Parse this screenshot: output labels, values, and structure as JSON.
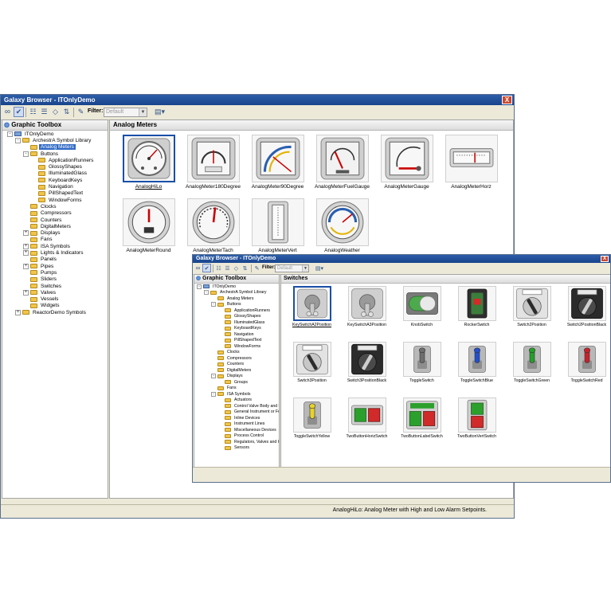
{
  "back_window": {
    "title": "Galaxy Browser - ITOnlyDemo",
    "close_label": "X",
    "filter_label": "Filter:",
    "filter_value": "Default",
    "left_panel_title": "Graphic Toolbox",
    "tree": [
      {
        "label": "ITOnlyDemo",
        "level": 0,
        "exp": "-",
        "icon": "lib"
      },
      {
        "label": "ArchestrA Symbol Library",
        "level": 1,
        "exp": "-",
        "icon": "folder"
      },
      {
        "label": "Analog Meters",
        "level": 2,
        "exp": "",
        "icon": "folder",
        "selected": true
      },
      {
        "label": "Buttons",
        "level": 2,
        "exp": "-",
        "icon": "folder"
      },
      {
        "label": "ApplicationRunners",
        "level": 3,
        "exp": "",
        "icon": "folder"
      },
      {
        "label": "GlossyShapes",
        "level": 3,
        "exp": "",
        "icon": "folder"
      },
      {
        "label": "IlluminatedGlass",
        "level": 3,
        "exp": "",
        "icon": "folder"
      },
      {
        "label": "KeyboardKeys",
        "level": 3,
        "exp": "",
        "icon": "folder"
      },
      {
        "label": "Navigation",
        "level": 3,
        "exp": "",
        "icon": "folder"
      },
      {
        "label": "PillShapedText",
        "level": 3,
        "exp": "",
        "icon": "folder"
      },
      {
        "label": "WindowForms",
        "level": 3,
        "exp": "",
        "icon": "folder"
      },
      {
        "label": "Clocks",
        "level": 2,
        "exp": "",
        "icon": "folder"
      },
      {
        "label": "Compressors",
        "level": 2,
        "exp": "",
        "icon": "folder"
      },
      {
        "label": "Counters",
        "level": 2,
        "exp": "",
        "icon": "folder"
      },
      {
        "label": "DigitalMeters",
        "level": 2,
        "exp": "",
        "icon": "folder"
      },
      {
        "label": "Displays",
        "level": 2,
        "exp": "+",
        "icon": "folder"
      },
      {
        "label": "Fans",
        "level": 2,
        "exp": "",
        "icon": "folder"
      },
      {
        "label": "ISA Symbols",
        "level": 2,
        "exp": "+",
        "icon": "folder"
      },
      {
        "label": "Lights & Indicators",
        "level": 2,
        "exp": "+",
        "icon": "folder"
      },
      {
        "label": "Panels",
        "level": 2,
        "exp": "",
        "icon": "folder"
      },
      {
        "label": "Pipes",
        "level": 2,
        "exp": "+",
        "icon": "folder"
      },
      {
        "label": "Pumps",
        "level": 2,
        "exp": "",
        "icon": "folder"
      },
      {
        "label": "Sliders",
        "level": 2,
        "exp": "",
        "icon": "folder"
      },
      {
        "label": "Switches",
        "level": 2,
        "exp": "",
        "icon": "folder"
      },
      {
        "label": "Valves",
        "level": 2,
        "exp": "+",
        "icon": "folder"
      },
      {
        "label": "Vessels",
        "level": 2,
        "exp": "",
        "icon": "folder"
      },
      {
        "label": "Widgets",
        "level": 2,
        "exp": "",
        "icon": "folder"
      },
      {
        "label": "ReactorDemo Symbols",
        "level": 1,
        "exp": "+",
        "icon": "folder"
      }
    ],
    "right_panel_title": "Analog Meters",
    "items": [
      {
        "name": "AnalogHiLo",
        "icon": "dial-gauge",
        "selected": true
      },
      {
        "name": "AnalogMeter180Degree",
        "icon": "half-dial-meter"
      },
      {
        "name": "AnalogMeter90Degree",
        "icon": "quarter-dial-meter"
      },
      {
        "name": "AnalogMeterFuelGauge",
        "icon": "fuel-gauge"
      },
      {
        "name": "AnalogMeterGauge",
        "icon": "square-gauge"
      },
      {
        "name": "AnalogMeterHorz",
        "icon": "horizontal-meter"
      },
      {
        "name": "AnalogMeterRound",
        "icon": "round-meter"
      },
      {
        "name": "AnalogMeterTach",
        "icon": "tachometer"
      },
      {
        "name": "AnalogMeterVert",
        "icon": "vertical-meter"
      },
      {
        "name": "AnalogWeather",
        "icon": "weather-gauge"
      }
    ],
    "status_text": "AnalogHiLo: Analog Meter with High and Low Alarm Setpoints."
  },
  "front_window": {
    "title": "Galaxy Browser - ITOnlyDemo",
    "close_label": "X",
    "filter_label": "Filter:",
    "filter_value": "Default",
    "left_panel_title": "Graphic Toolbox",
    "tree": [
      {
        "label": "ITOnlyDemo",
        "level": 0,
        "exp": "-",
        "icon": "lib"
      },
      {
        "label": "ArchestrA Symbol Library",
        "level": 1,
        "exp": "-",
        "icon": "folder"
      },
      {
        "label": "Analog Meters",
        "level": 2,
        "exp": "",
        "icon": "folder"
      },
      {
        "label": "Buttons",
        "level": 2,
        "exp": "-",
        "icon": "folder"
      },
      {
        "label": "ApplicationRunners",
        "level": 3,
        "exp": "",
        "icon": "folder"
      },
      {
        "label": "GlossyShapes",
        "level": 3,
        "exp": "",
        "icon": "folder"
      },
      {
        "label": "IlluminatedGlass",
        "level": 3,
        "exp": "",
        "icon": "folder"
      },
      {
        "label": "KeyboardKeys",
        "level": 3,
        "exp": "",
        "icon": "folder"
      },
      {
        "label": "Navigation",
        "level": 3,
        "exp": "",
        "icon": "folder"
      },
      {
        "label": "PillShapedText",
        "level": 3,
        "exp": "",
        "icon": "folder"
      },
      {
        "label": "WindowForms",
        "level": 3,
        "exp": "",
        "icon": "folder"
      },
      {
        "label": "Clocks",
        "level": 2,
        "exp": "",
        "icon": "folder"
      },
      {
        "label": "Compressors",
        "level": 2,
        "exp": "",
        "icon": "folder"
      },
      {
        "label": "Counters",
        "level": 2,
        "exp": "",
        "icon": "folder"
      },
      {
        "label": "DigitalMeters",
        "level": 2,
        "exp": "",
        "icon": "folder"
      },
      {
        "label": "Displays",
        "level": 2,
        "exp": "-",
        "icon": "folder"
      },
      {
        "label": "Groups",
        "level": 3,
        "exp": "",
        "icon": "folder"
      },
      {
        "label": "Fans",
        "level": 2,
        "exp": "",
        "icon": "folder"
      },
      {
        "label": "ISA Symbols",
        "level": 2,
        "exp": "-",
        "icon": "folder"
      },
      {
        "label": "Actuators",
        "level": 3,
        "exp": "",
        "icon": "folder"
      },
      {
        "label": "Control Valve Body and Da",
        "level": 3,
        "exp": "",
        "icon": "folder"
      },
      {
        "label": "General Instrument or Fu",
        "level": 3,
        "exp": "",
        "icon": "folder"
      },
      {
        "label": "Inline Devices",
        "level": 3,
        "exp": "",
        "icon": "folder"
      },
      {
        "label": "Instrument Lines",
        "level": 3,
        "exp": "",
        "icon": "folder"
      },
      {
        "label": "Miscellaneous Devices",
        "level": 3,
        "exp": "",
        "icon": "folder"
      },
      {
        "label": "Process Control",
        "level": 3,
        "exp": "",
        "icon": "folder"
      },
      {
        "label": "Regulators, Valves and Ot",
        "level": 3,
        "exp": "",
        "icon": "folder"
      },
      {
        "label": "Sensors",
        "level": 3,
        "exp": "",
        "icon": "folder"
      }
    ],
    "right_panel_title": "Switches",
    "items": [
      {
        "name": "KeySwitchA2Position",
        "icon": "key-switch",
        "selected": true
      },
      {
        "name": "KeySwitchA3Position",
        "icon": "key-switch"
      },
      {
        "name": "KnobSwitch",
        "icon": "knob-switch"
      },
      {
        "name": "RockerSwitch",
        "icon": "rocker-switch"
      },
      {
        "name": "Switch2Position",
        "icon": "selector-switch"
      },
      {
        "name": "Switch2PositionBlack",
        "icon": "selector-switch-black"
      },
      {
        "name": "Switch3Position",
        "icon": "selector-switch"
      },
      {
        "name": "Switch3PositionBlack",
        "icon": "selector-switch-black"
      },
      {
        "name": "ToggleSwitch",
        "icon": "toggle-gray"
      },
      {
        "name": "ToggleSwitchBlue",
        "icon": "toggle-blue"
      },
      {
        "name": "ToggleSwitchGreen",
        "icon": "toggle-green"
      },
      {
        "name": "ToggleSwitchRed",
        "icon": "toggle-red"
      },
      {
        "name": "ToggleSwitchYellow",
        "icon": "toggle-yellow"
      },
      {
        "name": "TwoButtonHorizSwitch",
        "icon": "two-button-horiz"
      },
      {
        "name": "TwoButtonLabelSwitch",
        "icon": "two-button-label"
      },
      {
        "name": "TwoButtonVertSwitch",
        "icon": "two-button-vert"
      }
    ]
  }
}
